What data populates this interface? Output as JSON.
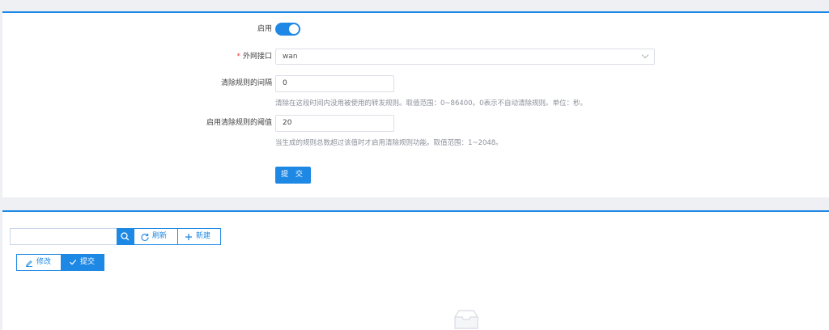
{
  "form": {
    "enable_label": "启用",
    "enable_value": true,
    "wan_required_mark": "*",
    "wan_label": "外网接口",
    "wan_value": "wan",
    "clear_interval_label": "清除规则的间隔",
    "clear_interval_value": "0",
    "clear_interval_hint": "清除在这段时间内没用被使用的转发规则。取值范围：0~86400。0表示不自动清除规则。单位：秒。",
    "threshold_label": "启用清除规则的阈值",
    "threshold_value": "20",
    "threshold_hint": "当生成的规则总数超过该值时才启用清除规则功能。取值范围：1~2048。",
    "submit_label": "提 交"
  },
  "toolbar": {
    "search_value": "",
    "refresh_label": "刷新",
    "new_label": "新建",
    "edit_label": "修改",
    "submit_label": "提交"
  },
  "colors": {
    "accent": "#1e88e5",
    "background": "#eef0f4",
    "required": "#e53935"
  },
  "icons": [
    "search-icon",
    "refresh-icon",
    "plus-icon",
    "edit-icon",
    "check-icon",
    "empty-inbox-icon",
    "chevron-down-icon"
  ]
}
